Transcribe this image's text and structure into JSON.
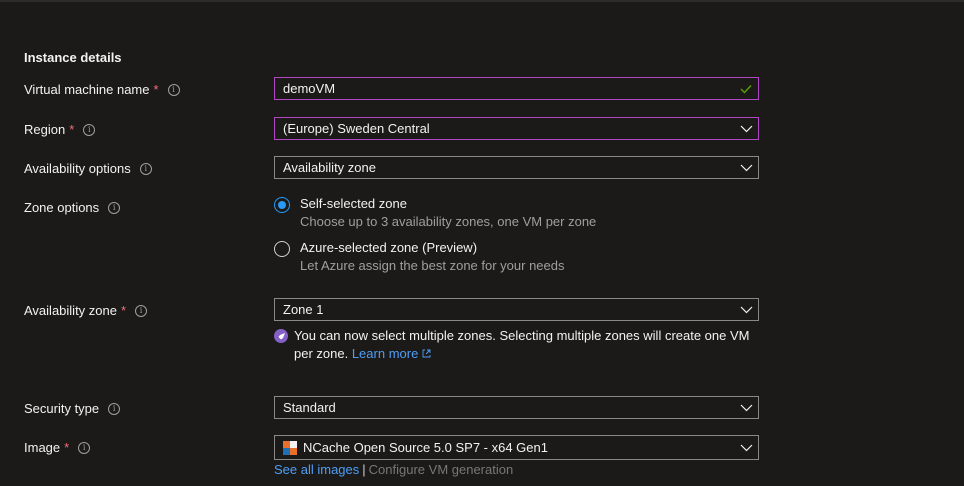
{
  "section_title": "Instance details",
  "fields": {
    "vm_name": {
      "label": "Virtual machine name",
      "required": "*",
      "value": "demoVM"
    },
    "region": {
      "label": "Region",
      "required": "*",
      "value": "(Europe) Sweden Central"
    },
    "availability_options": {
      "label": "Availability options",
      "value": "Availability zone"
    },
    "zone_options": {
      "label": "Zone options",
      "self_selected": {
        "title": "Self-selected zone",
        "desc": "Choose up to 3 availability zones, one VM per zone",
        "selected": true
      },
      "azure_selected": {
        "title": "Azure-selected zone (Preview)",
        "desc": "Let Azure assign the best zone for your needs",
        "selected": false
      }
    },
    "availability_zone": {
      "label": "Availability zone",
      "required": "*",
      "value": "Zone 1",
      "note_text": "You can now select multiple zones. Selecting multiple zones will create one VM per zone.",
      "note_link": "Learn more"
    },
    "security_type": {
      "label": "Security type",
      "value": "Standard"
    },
    "image": {
      "label": "Image",
      "required": "*",
      "value": "NCache Open Source 5.0 SP7 - x64 Gen1",
      "see_all": "See all images",
      "separator": "|",
      "configure": "Configure VM generation"
    }
  },
  "info_glyph": "i",
  "colors": {
    "accent": "#b146c2",
    "link": "#4f9ef6",
    "radio": "#2899f5",
    "required": "#f1707b",
    "valid": "#57a300"
  }
}
